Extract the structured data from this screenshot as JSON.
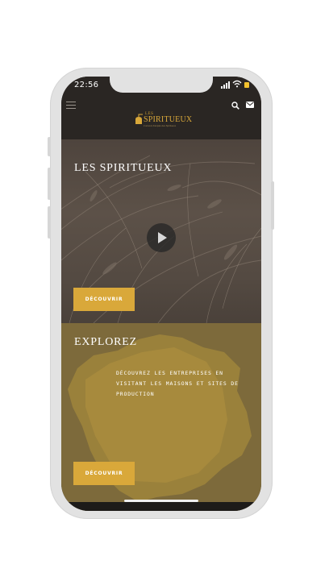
{
  "status_bar": {
    "time": "22:56",
    "battery_color": "#f2c12e"
  },
  "header": {
    "menu_icon": "hamburger-icon",
    "search_icon": "search-icon",
    "mail_icon": "mail-icon",
    "logo": {
      "les": "LES",
      "title": "SPIRITUEUX",
      "tagline": "L'univers français des Spiritueux"
    }
  },
  "hero": {
    "title": "LES SPIRITUEUX",
    "play_icon": "play-icon",
    "button_label": "DÉCOUVRIR"
  },
  "explore": {
    "title": "EXPLOREZ",
    "description": "DÉCOUVREZ LES ENTREPRISES EN VISITANT LES MAISONS ET SITES DE PRODUCTION",
    "button_label": "DÉCOUVRIR"
  },
  "colors": {
    "header_bg": "#2a2623",
    "accent_gold": "#d9a83a",
    "explore_bg": "#7d6a3b",
    "text": "#ffffff"
  }
}
